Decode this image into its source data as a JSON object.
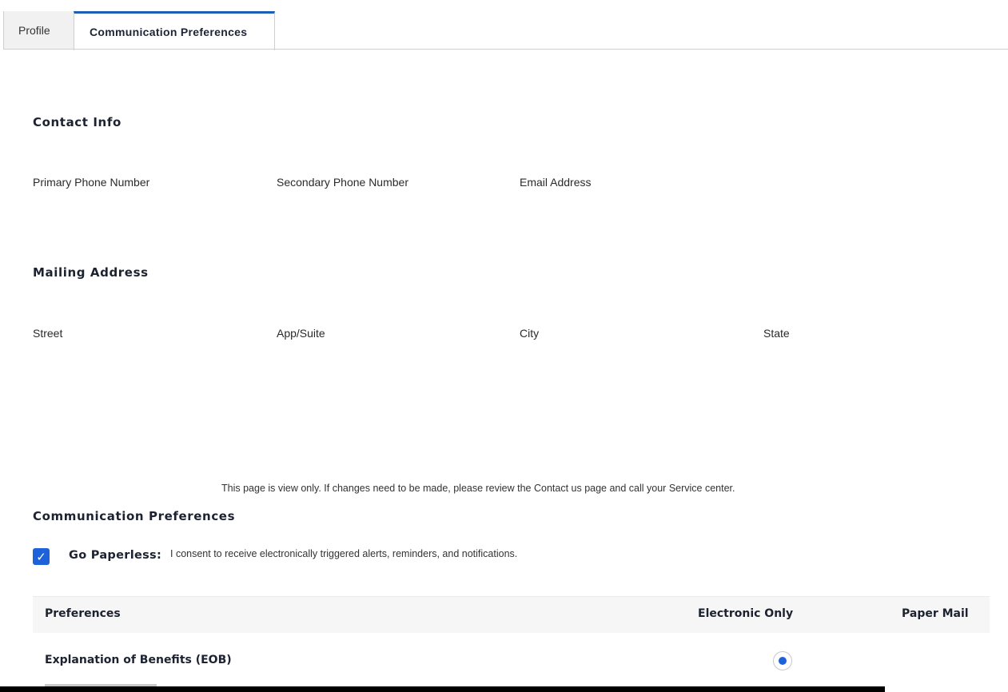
{
  "tabs": [
    {
      "label": "Profile",
      "active": false
    },
    {
      "label": "Communication Preferences",
      "active": true
    }
  ],
  "contact": {
    "heading": "Contact Info",
    "fields": [
      "Primary Phone Number",
      "Secondary Phone Number",
      "Email Address"
    ]
  },
  "mailing": {
    "heading": "Mailing Address",
    "fields": [
      "Street",
      "App/Suite",
      "City",
      "State"
    ]
  },
  "notice": "This page is view only. If changes need to be made, please review the Contact us page and call your Service center.",
  "preferences": {
    "heading": "Communication Preferences",
    "paperless_checked": true,
    "paperless_label": "Go Paperless:",
    "consent_text": "I consent to receive electronically triggered alerts, reminders, and notifications.",
    "table": {
      "columns": [
        "Preferences",
        "Electronic Only",
        "Paper Mail"
      ],
      "rows": [
        {
          "label": "Explanation of Benefits (EOB)",
          "selected": "Electronic Only"
        }
      ]
    }
  },
  "colors": {
    "accent": "#1d62d8",
    "tab_border": "#1a5fb4"
  }
}
